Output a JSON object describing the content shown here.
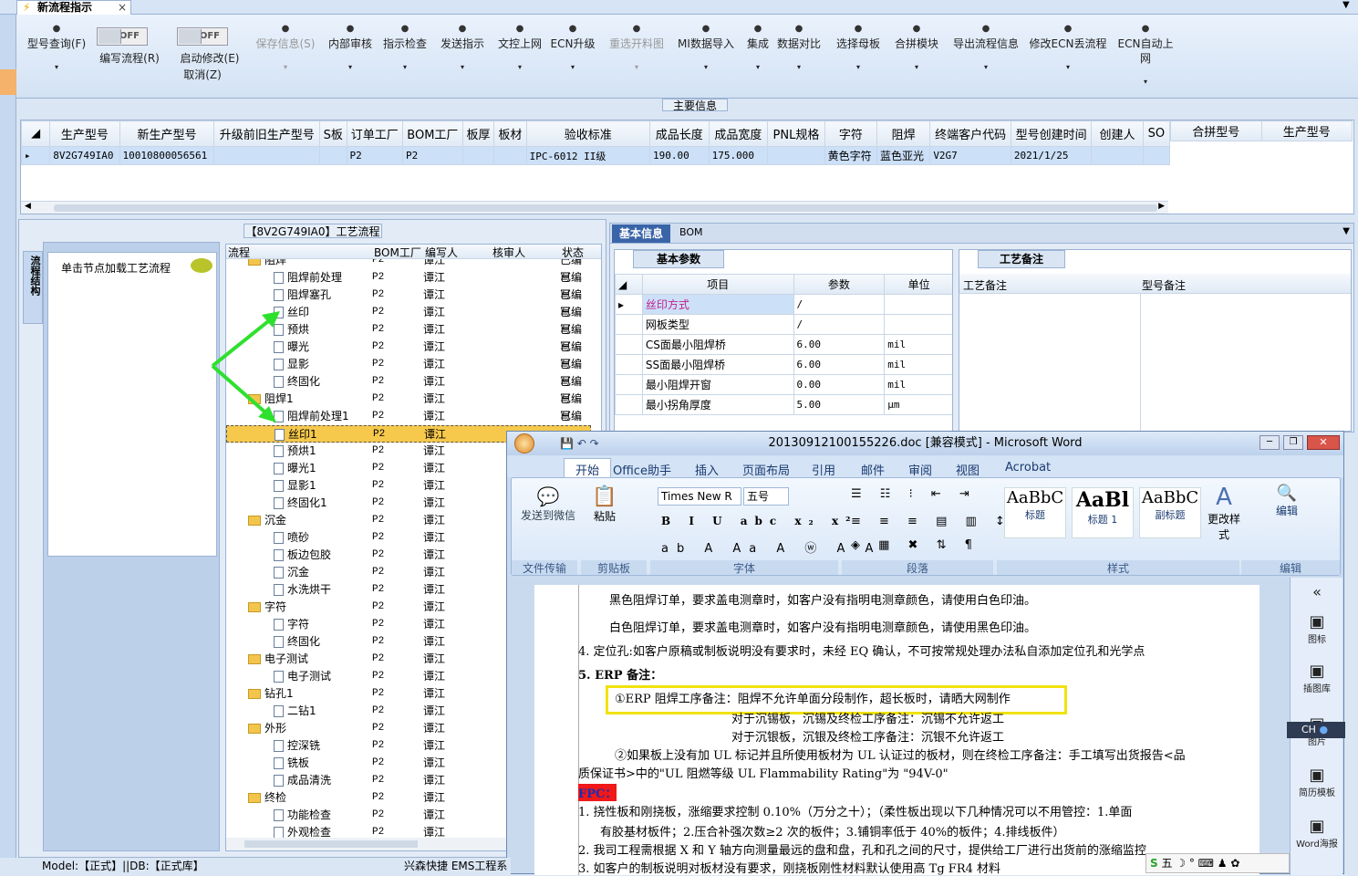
{
  "app": {
    "tab_title": "新流程指示",
    "tab_close": "×"
  },
  "toolbar": {
    "items": [
      {
        "label": "型号查询(F)",
        "icon": "search-icon"
      },
      {
        "label": "编写流程(R)"
      },
      {
        "label": "启动修改(E)",
        "sub": "取消(Z)"
      },
      {
        "label": "保存信息(S)",
        "icon": "check-icon"
      },
      {
        "label": "内部审核",
        "icon": "printer-icon"
      },
      {
        "label": "指示检查",
        "icon": "checkbox-icon"
      },
      {
        "label": "发送指示",
        "icon": "upload-icon"
      },
      {
        "label": "文控上网",
        "icon": "cloud-icon"
      },
      {
        "label": "ECN升级",
        "icon": "tool-icon"
      },
      {
        "label": "重选开料图",
        "icon": "image-icon"
      },
      {
        "label": "MI数据导入",
        "icon": "import-icon"
      },
      {
        "label": "集成",
        "icon": "download-icon"
      },
      {
        "label": "数据对比",
        "icon": "compare-icon"
      },
      {
        "label": "选择母板",
        "icon": "shuffle-icon"
      },
      {
        "label": "合拼模块",
        "icon": "list-icon"
      },
      {
        "label": "导出流程信息",
        "icon": "smile-icon"
      },
      {
        "label": "修改ECN丢流程",
        "icon": "wrench-icon"
      },
      {
        "label": "ECN自动上网",
        "icon": "star-icon"
      }
    ],
    "toggle_off": "OFF"
  },
  "main_info": {
    "title": "主要信息",
    "columns": [
      "生产型号",
      "新生产型号",
      "升级前旧生产型号",
      "S板",
      "订单工厂",
      "BOM工厂",
      "板厚",
      "板材",
      "验收标准",
      "成品长度",
      "成品宽度",
      "PNL规格",
      "字符",
      "阻焊",
      "终端客户代码",
      "型号创建时间",
      "创建人",
      "SO"
    ],
    "row": [
      "8V2G749IA0",
      "10010800056561",
      "",
      "",
      "P2",
      "P2",
      "",
      "",
      "IPC-6012 II级",
      "190.00",
      "175.000",
      "",
      "黄色字符",
      "蓝色亚光",
      "V2G7",
      "2021/1/25",
      "",
      ""
    ],
    "side_columns": [
      "合拼型号",
      "生产型号"
    ]
  },
  "process": {
    "title": "【8V2G749IA0】工艺流程",
    "side_tab": "流程结构",
    "hint": "单击节点加载工艺流程",
    "columns": [
      "流程",
      "BOM工厂",
      "编写人",
      "核审人",
      "状态"
    ],
    "rows": [
      {
        "name": "阻焊",
        "folder": true,
        "bom": "P2",
        "writer": "谭江",
        "status": "已编写"
      },
      {
        "name": "阻焊前处理",
        "bom": "P2",
        "writer": "谭江",
        "status": "已编写"
      },
      {
        "name": "阻焊塞孔",
        "bom": "P2",
        "writer": "谭江",
        "status": "已编写"
      },
      {
        "name": "丝印",
        "bom": "P2",
        "writer": "谭江",
        "status": "已编写"
      },
      {
        "name": "预烘",
        "bom": "P2",
        "writer": "谭江",
        "status": "已编写"
      },
      {
        "name": "曝光",
        "bom": "P2",
        "writer": "谭江",
        "status": "已编写"
      },
      {
        "name": "显影",
        "bom": "P2",
        "writer": "谭江",
        "status": "已编写"
      },
      {
        "name": "终固化",
        "bom": "P2",
        "writer": "谭江",
        "status": "已编写"
      },
      {
        "name": "阻焊1",
        "folder": true,
        "bom": "P2",
        "writer": "谭江",
        "status": "已编写"
      },
      {
        "name": "阻焊前处理1",
        "bom": "P2",
        "writer": "谭江",
        "status": "已编写"
      },
      {
        "name": "丝印1",
        "bom": "P2",
        "writer": "谭江",
        "status": "",
        "selected": true
      },
      {
        "name": "预烘1",
        "bom": "P2",
        "writer": "谭江",
        "status": ""
      },
      {
        "name": "曝光1",
        "bom": "P2",
        "writer": "谭江",
        "status": ""
      },
      {
        "name": "显影1",
        "bom": "P2",
        "writer": "谭江",
        "status": ""
      },
      {
        "name": "终固化1",
        "bom": "P2",
        "writer": "谭江",
        "status": ""
      },
      {
        "name": "沉金",
        "folder": true,
        "bom": "P2",
        "writer": "谭江",
        "status": ""
      },
      {
        "name": "喷砂",
        "bom": "P2",
        "writer": "谭江",
        "status": ""
      },
      {
        "name": "板边包胶",
        "bom": "P2",
        "writer": "谭江",
        "status": ""
      },
      {
        "name": "沉金",
        "bom": "P2",
        "writer": "谭江",
        "status": ""
      },
      {
        "name": "水洗烘干",
        "bom": "P2",
        "writer": "谭江",
        "status": ""
      },
      {
        "name": "字符",
        "folder": true,
        "bom": "P2",
        "writer": "谭江",
        "status": ""
      },
      {
        "name": "字符",
        "bom": "P2",
        "writer": "谭江",
        "status": ""
      },
      {
        "name": "终固化",
        "bom": "P2",
        "writer": "谭江",
        "status": ""
      },
      {
        "name": "电子测试",
        "folder": true,
        "bom": "P2",
        "writer": "谭江",
        "status": ""
      },
      {
        "name": "电子测试",
        "bom": "P2",
        "writer": "谭江",
        "status": ""
      },
      {
        "name": "钻孔1",
        "folder": true,
        "bom": "P2",
        "writer": "谭江",
        "status": ""
      },
      {
        "name": "二钻1",
        "bom": "P2",
        "writer": "谭江",
        "status": ""
      },
      {
        "name": "外形",
        "folder": true,
        "bom": "P2",
        "writer": "谭江",
        "status": ""
      },
      {
        "name": "控深铣",
        "bom": "P2",
        "writer": "谭江",
        "status": ""
      },
      {
        "name": "铣板",
        "bom": "P2",
        "writer": "谭江",
        "status": ""
      },
      {
        "name": "成品清洗",
        "bom": "P2",
        "writer": "谭江",
        "status": ""
      },
      {
        "name": "终检",
        "folder": true,
        "bom": "P2",
        "writer": "谭江",
        "status": ""
      },
      {
        "name": "功能检查",
        "bom": "P2",
        "writer": "谭江",
        "status": ""
      },
      {
        "name": "外观检查",
        "bom": "P2",
        "writer": "谭江",
        "status": ""
      }
    ]
  },
  "basic": {
    "tabs": [
      "基本信息",
      "BOM"
    ],
    "subtab": "基本参数",
    "columns": [
      "项目",
      "参数",
      "单位"
    ],
    "rows": [
      [
        "丝印方式",
        "/",
        ""
      ],
      [
        "网板类型",
        "/",
        ""
      ],
      [
        "CS面最小阻焊桥",
        "6.00",
        "mil"
      ],
      [
        "SS面最小阻焊桥",
        "6.00",
        "mil"
      ],
      [
        "最小阻焊开窗",
        "0.00",
        "mil"
      ],
      [
        "最小拐角厚度",
        "5.00",
        "μm"
      ]
    ],
    "craft_tab": "工艺备注",
    "craft_cols": [
      "工艺备注",
      "型号备注"
    ]
  },
  "word": {
    "title": "20130912100155226.doc [兼容模式] - Microsoft Word",
    "tabs": [
      "开始",
      "Office助手",
      "插入",
      "页面布局",
      "引用",
      "邮件",
      "审阅",
      "视图",
      "Acrobat"
    ],
    "font": "Times New R",
    "size": "五号",
    "groups": [
      "文件传输",
      "剪贴板",
      "字体",
      "段落",
      "样式",
      "编辑"
    ],
    "send_wechat": "发送到微信",
    "paste": "粘贴",
    "styles": [
      {
        "sample": "AaBbC",
        "name": "标题"
      },
      {
        "sample": "AaBl",
        "name": "标题 1"
      },
      {
        "sample": "AaBbC",
        "name": "副标题"
      }
    ],
    "change_style": "更改样式",
    "edit": "编辑",
    "lines": [
      "黑色阻焊订单，要求盖电测章时，如客户没有指明电测章颜色，请使用白色印油。",
      "白色阻焊订单，要求盖电测章时，如客户没有指明电测章颜色，请使用黑色印油。",
      "4. 定位孔:如客户原稿或制板说明没有要求时，未经 EQ 确认，不可按常规处理办法私自添加定位孔和光学点",
      "5. ERP 备注：",
      "①ERP 阻焊工序备注：阻焊不允许单面分段制作，超长板时，请晒大网制作",
      "对于沉锡板，沉锡及终检工序备注：沉锡不允许返工",
      "对于沉银板，沉银及终检工序备注：沉银不允许返工",
      "②如果板上没有加 UL 标记并且所使用板材为 UL 认证过的板材，则在终检工序备注：手工填写出货报告<品",
      "质保证书>中的\"UL 阻燃等级 UL Flammability Rating\"为 \"94V-0\"",
      "FPC：",
      "1.  挠性板和刚挠板，涨缩要求控制 0.10%（万分之十）；（柔性板出现以下几种情况可以不用管控：1.单面",
      "有胶基材板件；2.压合补强次数≥2 次的板件；3.铺铜率低于 40%的板件；4.排线板件）",
      "2.  我司工程需根据 X 和 Y 轴方向测量最远的盘和盘，孔和孔之间的尺寸，提供给工厂进行出货前的涨缩监控",
      "3. 如客户的制板说明对板材没有要求，刚挠板刚性材料默认使用高 Tg FR4 材料"
    ],
    "right_items": [
      "图标",
      "插图库",
      "图片",
      "简历模板",
      "Word海报"
    ],
    "ime": "CH"
  },
  "status": {
    "text": "Model:【正式】||DB:【正式库】",
    "right": "兴森快捷 EMS工程系"
  }
}
